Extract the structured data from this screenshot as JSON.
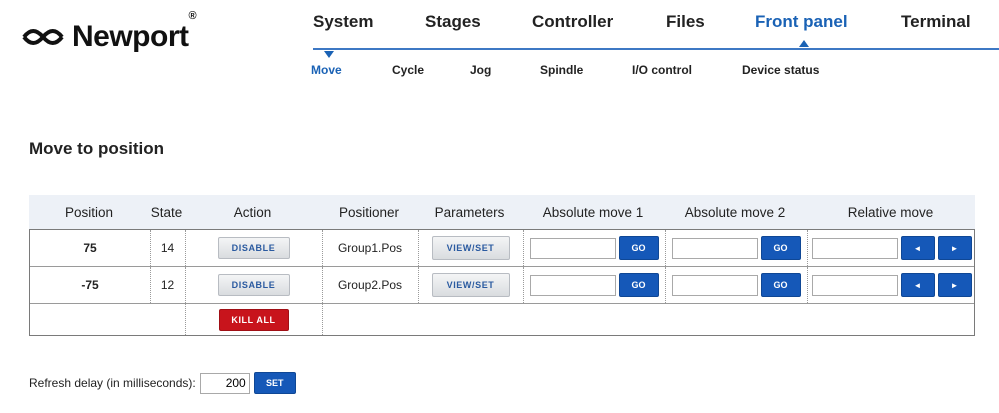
{
  "logo": {
    "text": "Newport",
    "reg": "®"
  },
  "main_nav": {
    "tabs": [
      "System",
      "Stages",
      "Controller",
      "Files",
      "Front panel",
      "Terminal"
    ],
    "active": "Front panel"
  },
  "sub_nav": {
    "tabs": [
      "Move",
      "Cycle",
      "Jog",
      "Spindle",
      "I/O control",
      "Device status"
    ],
    "active": "Move"
  },
  "section_title": "Move to position",
  "table": {
    "headers": [
      "Position",
      "State",
      "Action",
      "Positioner",
      "Parameters",
      "Absolute move 1",
      "Absolute move 2",
      "Relative move"
    ],
    "rows": [
      {
        "position": "75",
        "state": "14",
        "action": "DISABLE",
        "positioner": "Group1.Pos",
        "parameters": "VIEW/SET",
        "abs1_value": "",
        "abs1_btn": "GO",
        "abs2_value": "",
        "abs2_btn": "GO",
        "rel_value": "",
        "rel_left": "◄",
        "rel_right": "►"
      },
      {
        "position": "-75",
        "state": "12",
        "action": "DISABLE",
        "positioner": "Group2.Pos",
        "parameters": "VIEW/SET",
        "abs1_value": "",
        "abs1_btn": "GO",
        "abs2_value": "",
        "abs2_btn": "GO",
        "rel_value": "",
        "rel_left": "◄",
        "rel_right": "►"
      }
    ],
    "kill_all": "KILL ALL"
  },
  "refresh": {
    "label": "Refresh delay (in milliseconds):",
    "value": "200",
    "button": "SET"
  },
  "colors": {
    "accent": "#1a62b5",
    "danger": "#c8141c",
    "header_bg": "#edf1f7"
  }
}
